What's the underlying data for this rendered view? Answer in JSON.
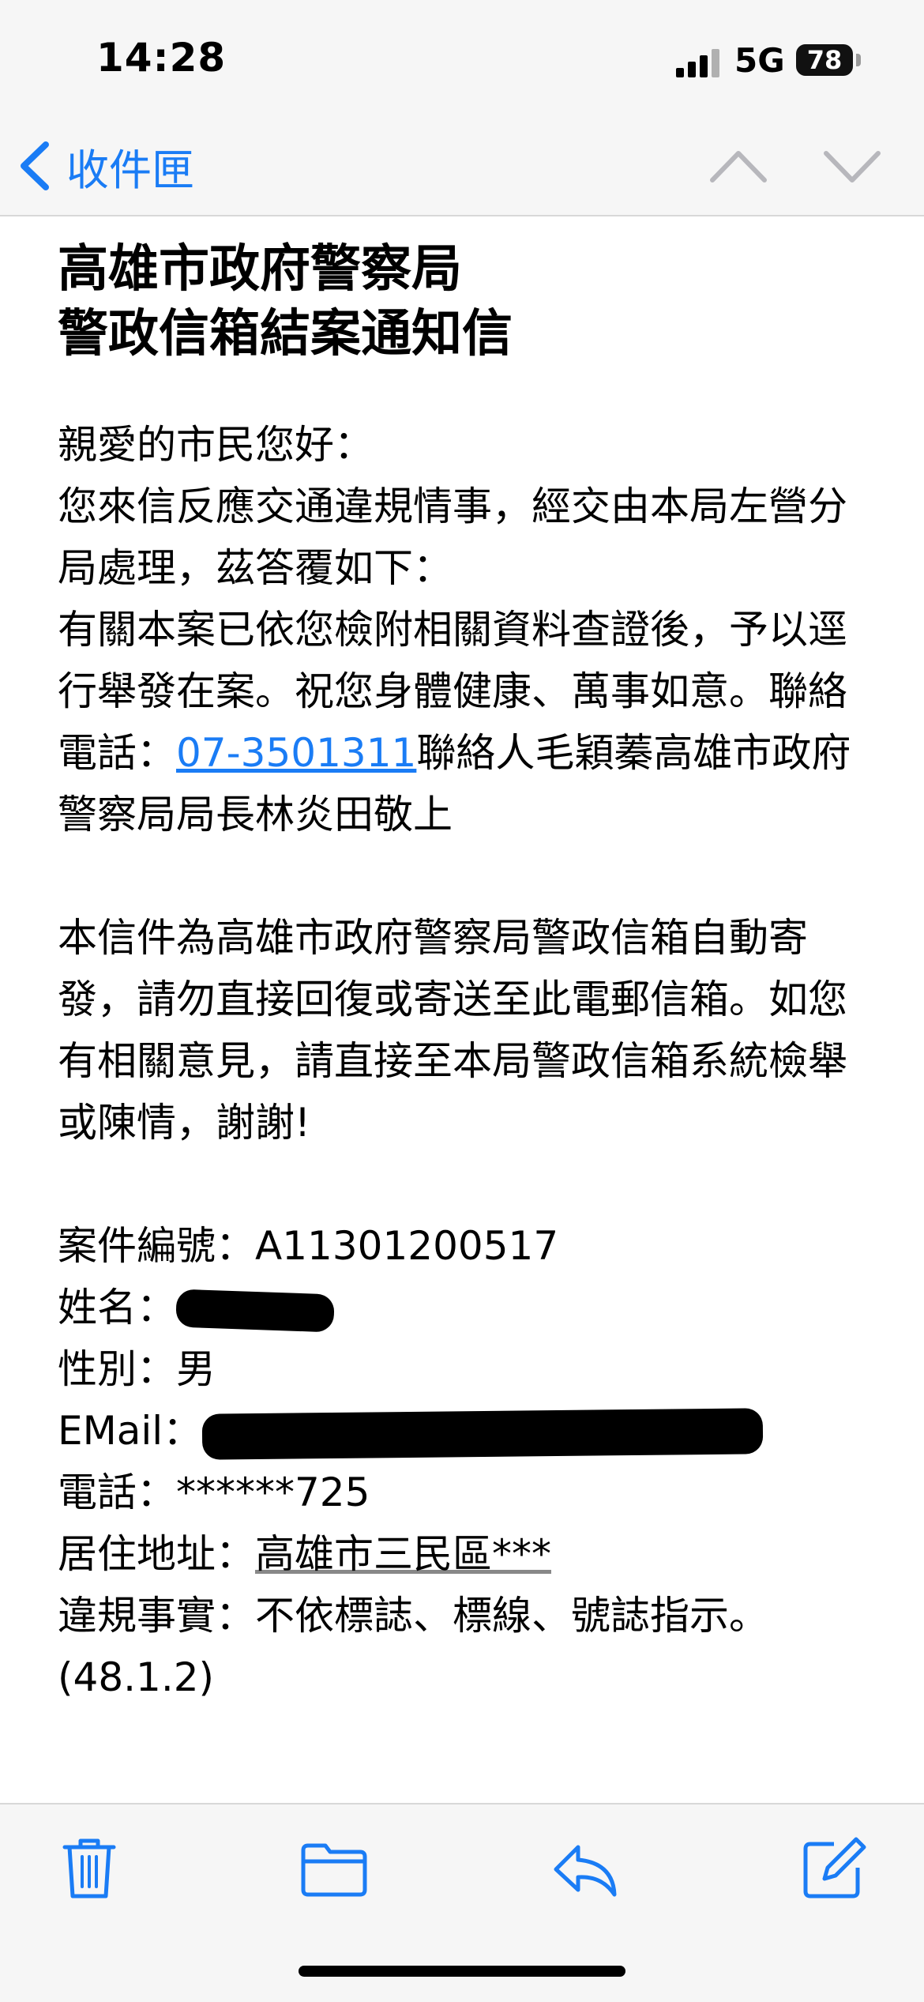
{
  "status_bar": {
    "time": "14:28",
    "network": "5G",
    "battery": "78"
  },
  "nav": {
    "back_label": "收件匣"
  },
  "email": {
    "title_line1": "高雄市政府警察局",
    "title_line2": "警政信箱結案通知信",
    "greeting": "親愛的市民您好：",
    "body1": "您來信反應交通違規情事，經交由本局左營分局處理，茲答覆如下：",
    "body2_before": "有關本案已依您檢附相關資料查證後，予以逕行舉發在案。祝您身體健康、萬事如意。聯絡電話：",
    "phone_link": "07-3501311",
    "body2_after": "聯絡人毛穎蓁高雄市政府警察局局長林炎田敬上",
    "notice": "本信件為高雄市政府警察局警政信箱自動寄發，請勿直接回復或寄送至此電郵信箱。如您有相關意見，請直接至本局警政信箱系統檢舉或陳情，謝謝!",
    "fields": {
      "case_label": "案件編號：",
      "case_value": "A11301200517",
      "name_label": "姓名：",
      "gender_label": "性別：",
      "gender_value": "男",
      "email_label": "EMail：",
      "phone_label": "電話：",
      "phone_value": "******725",
      "address_label": "居住地址：",
      "address_value": "高雄市三民區***",
      "violation_label": "違規事實：",
      "violation_value": "不依標誌、標線、號誌指示。(48.1.2)"
    }
  },
  "colors": {
    "accent": "#1a7cf5",
    "bar_bg": "#f6f6f6",
    "disabled": "#b7b7bc"
  },
  "icons": [
    "chevron-left-icon",
    "chevron-up-icon",
    "chevron-down-icon",
    "trash-icon",
    "folder-icon",
    "reply-icon",
    "compose-icon"
  ]
}
